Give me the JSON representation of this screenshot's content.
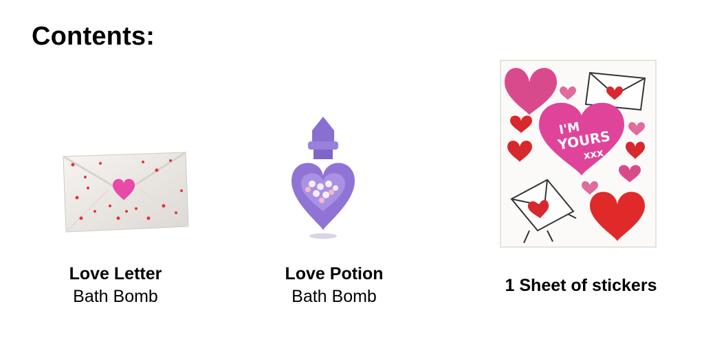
{
  "heading": "Contents:",
  "items": [
    {
      "name": "Love Letter",
      "kind": "Bath Bomb",
      "image": "envelope-bath-bomb-image"
    },
    {
      "name": "Love Potion",
      "kind": "Bath Bomb",
      "image": "potion-bottle-bath-bomb-image"
    },
    {
      "name": "1 Sheet of stickers",
      "kind": "",
      "image": "heart-sticker-sheet-image"
    }
  ],
  "sticker_text": [
    "I'M",
    "YOURS",
    "xxx"
  ],
  "colors": {
    "pink": "#d94a8c",
    "red": "#e02a2a",
    "purple": "#8f74d6"
  }
}
